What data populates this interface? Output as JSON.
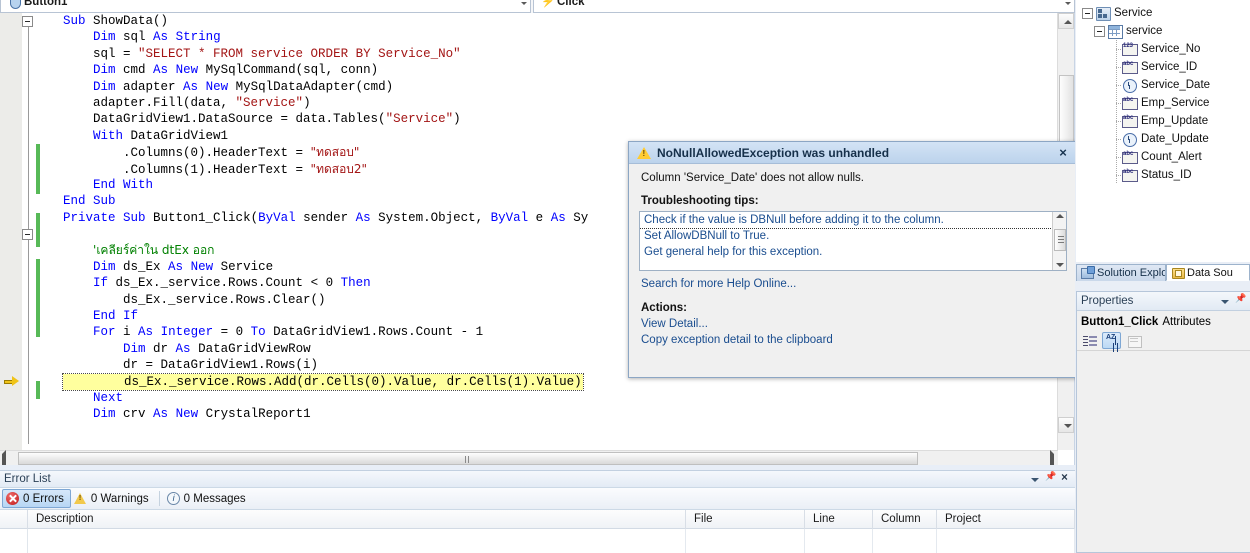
{
  "editor": {
    "object_combo": {
      "value": "Button1",
      "icon": "shield-icon"
    },
    "event_combo": {
      "value": "Click",
      "icon": "event-bolt-icon"
    },
    "code_lines": [
      {
        "indent": 0,
        "tokens": [
          {
            "t": "kw",
            "s": "Sub"
          },
          {
            "t": "p",
            "s": " ShowData()"
          }
        ]
      },
      {
        "indent": 1,
        "tokens": [
          {
            "t": "kw",
            "s": "Dim"
          },
          {
            "t": "p",
            "s": " sql "
          },
          {
            "t": "kw",
            "s": "As"
          },
          {
            "t": "p",
            "s": " "
          },
          {
            "t": "kw",
            "s": "String"
          }
        ]
      },
      {
        "indent": 1,
        "tokens": [
          {
            "t": "p",
            "s": "sql = "
          },
          {
            "t": "str",
            "s": "\"SELECT * FROM service ORDER BY Service_No\""
          }
        ]
      },
      {
        "indent": 1,
        "tokens": [
          {
            "t": "kw",
            "s": "Dim"
          },
          {
            "t": "p",
            "s": " cmd "
          },
          {
            "t": "kw",
            "s": "As"
          },
          {
            "t": "p",
            "s": " "
          },
          {
            "t": "kw",
            "s": "New"
          },
          {
            "t": "p",
            "s": " MySqlCommand(sql, conn)"
          }
        ]
      },
      {
        "indent": 1,
        "tokens": [
          {
            "t": "kw",
            "s": "Dim"
          },
          {
            "t": "p",
            "s": " adapter "
          },
          {
            "t": "kw",
            "s": "As"
          },
          {
            "t": "p",
            "s": " "
          },
          {
            "t": "kw",
            "s": "New"
          },
          {
            "t": "p",
            "s": " MySqlDataAdapter(cmd)"
          }
        ]
      },
      {
        "indent": 1,
        "tokens": [
          {
            "t": "p",
            "s": "adapter.Fill(data, "
          },
          {
            "t": "str",
            "s": "\"Service\""
          },
          {
            "t": "p",
            "s": ")"
          }
        ]
      },
      {
        "indent": 1,
        "tokens": [
          {
            "t": "p",
            "s": "DataGridView1.DataSource = data.Tables("
          },
          {
            "t": "str",
            "s": "\"Service\""
          },
          {
            "t": "p",
            "s": ")"
          }
        ]
      },
      {
        "indent": 1,
        "tokens": [
          {
            "t": "kw",
            "s": "With"
          },
          {
            "t": "p",
            "s": " DataGridView1"
          }
        ]
      },
      {
        "indent": 2,
        "tokens": [
          {
            "t": "p",
            "s": ".Columns(0).HeaderText = "
          },
          {
            "t": "str",
            "s": "\"ทดสอบ\"",
            "thai": true
          }
        ]
      },
      {
        "indent": 2,
        "tokens": [
          {
            "t": "p",
            "s": ".Columns(1).HeaderText = "
          },
          {
            "t": "str",
            "s": "\"ทดสอบ2\"",
            "thai": true
          }
        ]
      },
      {
        "indent": 1,
        "tokens": [
          {
            "t": "kw",
            "s": "End"
          },
          {
            "t": "p",
            "s": " "
          },
          {
            "t": "kw",
            "s": "With"
          }
        ]
      },
      {
        "indent": 0,
        "tokens": [
          {
            "t": "kw",
            "s": "End"
          },
          {
            "t": "p",
            "s": " "
          },
          {
            "t": "kw",
            "s": "Sub"
          }
        ]
      },
      {
        "indent": 0,
        "tokens": [
          {
            "t": "kw",
            "s": "Private"
          },
          {
            "t": "p",
            "s": " "
          },
          {
            "t": "kw",
            "s": "Sub"
          },
          {
            "t": "p",
            "s": " Button1_Click("
          },
          {
            "t": "kw",
            "s": "ByVal"
          },
          {
            "t": "p",
            "s": " sender "
          },
          {
            "t": "kw",
            "s": "As"
          },
          {
            "t": "p",
            "s": " System.Object, "
          },
          {
            "t": "kw",
            "s": "ByVal"
          },
          {
            "t": "p",
            "s": " e "
          },
          {
            "t": "kw",
            "s": "As"
          },
          {
            "t": "p",
            "s": " Sy"
          }
        ]
      },
      {
        "indent": 0,
        "tokens": []
      },
      {
        "indent": 1,
        "tokens": [
          {
            "t": "cmt",
            "s": "'เคลียร์ค่าใน dtEx ออก",
            "thai": true
          }
        ]
      },
      {
        "indent": 1,
        "tokens": [
          {
            "t": "kw",
            "s": "Dim"
          },
          {
            "t": "p",
            "s": " ds_Ex "
          },
          {
            "t": "kw",
            "s": "As"
          },
          {
            "t": "p",
            "s": " "
          },
          {
            "t": "kw",
            "s": "New"
          },
          {
            "t": "p",
            "s": " Service"
          }
        ]
      },
      {
        "indent": 1,
        "tokens": [
          {
            "t": "kw",
            "s": "If"
          },
          {
            "t": "p",
            "s": " ds_Ex._service.Rows.Count < 0 "
          },
          {
            "t": "kw",
            "s": "Then"
          }
        ]
      },
      {
        "indent": 2,
        "tokens": [
          {
            "t": "p",
            "s": "ds_Ex._service.Rows.Clear()"
          }
        ]
      },
      {
        "indent": 1,
        "tokens": [
          {
            "t": "kw",
            "s": "End"
          },
          {
            "t": "p",
            "s": " "
          },
          {
            "t": "kw",
            "s": "If"
          }
        ]
      },
      {
        "indent": 1,
        "tokens": [
          {
            "t": "kw",
            "s": "For"
          },
          {
            "t": "p",
            "s": " i "
          },
          {
            "t": "kw",
            "s": "As"
          },
          {
            "t": "p",
            "s": " "
          },
          {
            "t": "kw",
            "s": "Integer"
          },
          {
            "t": "p",
            "s": " = 0 "
          },
          {
            "t": "kw",
            "s": "To"
          },
          {
            "t": "p",
            "s": " DataGridView1.Rows.Count - 1"
          }
        ]
      },
      {
        "indent": 2,
        "tokens": [
          {
            "t": "kw",
            "s": "Dim"
          },
          {
            "t": "p",
            "s": " dr "
          },
          {
            "t": "kw",
            "s": "As"
          },
          {
            "t": "p",
            "s": " DataGridViewRow"
          }
        ]
      },
      {
        "indent": 2,
        "tokens": [
          {
            "t": "p",
            "s": "dr = DataGridView1.Rows(i)"
          }
        ]
      },
      {
        "indent": 2,
        "highlight": true,
        "current": true,
        "tokens": [
          {
            "t": "p",
            "s": "ds_Ex._service.Rows.Add(dr.Cells(0).Value, dr.Cells(1).Value)"
          }
        ]
      },
      {
        "indent": 1,
        "tokens": [
          {
            "t": "kw",
            "s": "Next"
          }
        ]
      },
      {
        "indent": 1,
        "tokens": [
          {
            "t": "kw",
            "s": "Dim"
          },
          {
            "t": "p",
            "s": " crv "
          },
          {
            "t": "kw",
            "s": "As"
          },
          {
            "t": "p",
            "s": " "
          },
          {
            "t": "kw",
            "s": "New"
          },
          {
            "t": "p",
            "s": " CrystalReport1"
          }
        ]
      }
    ]
  },
  "exception_dialog": {
    "title": "NoNullAllowedException was unhandled",
    "icon": "warning-icon",
    "close_label": "×",
    "message": "Column 'Service_Date' does not allow nulls.",
    "tips_label": "Troubleshooting tips:",
    "tips": [
      "Check if the value is DBNull before adding it to the column.",
      "Set AllowDBNull to True.",
      "Get general help for this exception."
    ],
    "search_link": "Search for more Help Online...",
    "actions_label": "Actions:",
    "actions": [
      "View Detail...",
      "Copy exception detail to the clipboard"
    ]
  },
  "data_sources": {
    "tree": [
      {
        "label": "Service",
        "level": 1,
        "icon": "dataset-icon",
        "expander": true
      },
      {
        "label": "service",
        "level": 2,
        "icon": "table-icon",
        "expander": true
      },
      {
        "label": "Service_No",
        "level": 3,
        "icon": "number-column-icon"
      },
      {
        "label": "Service_ID",
        "level": 3,
        "icon": "text-column-icon"
      },
      {
        "label": "Service_Date",
        "level": 3,
        "icon": "datetime-column-icon"
      },
      {
        "label": "Emp_Service",
        "level": 3,
        "icon": "text-column-icon"
      },
      {
        "label": "Emp_Update",
        "level": 3,
        "icon": "text-column-icon"
      },
      {
        "label": "Date_Update",
        "level": 3,
        "icon": "datetime-column-icon"
      },
      {
        "label": "Count_Alert",
        "level": 3,
        "icon": "text-column-icon"
      },
      {
        "label": "Status_ID",
        "level": 3,
        "icon": "text-column-icon"
      }
    ],
    "tabs": [
      {
        "label": "Solution Explo...",
        "icon": "solution-explorer-icon",
        "active": false
      },
      {
        "label": "Data Sou",
        "icon": "data-sources-icon",
        "active": true
      }
    ]
  },
  "properties": {
    "title": "Properties",
    "subject": "Button1_Click",
    "subject_suffix": "Attributes",
    "toolbar": [
      {
        "name": "categorized-button",
        "selected": false
      },
      {
        "name": "alphabetical-button",
        "selected": true
      },
      {
        "name": "property-pages-button",
        "selected": false,
        "disabled": true
      }
    ]
  },
  "error_list": {
    "title": "Error List",
    "counts": {
      "errors": "0 Errors",
      "warnings": "0 Warnings",
      "messages": "0 Messages"
    },
    "columns": [
      "Description",
      "File",
      "Line",
      "Column",
      "Project"
    ]
  }
}
